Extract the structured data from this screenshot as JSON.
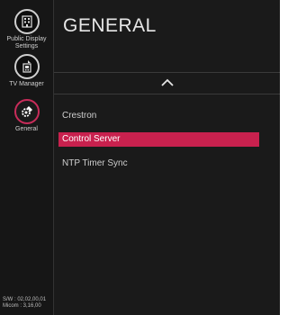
{
  "sidebar": {
    "items": [
      {
        "label": "Public Display\nSettings",
        "icon": "building-icon",
        "active": false
      },
      {
        "label": "TV Manager",
        "icon": "tv-manager-icon",
        "active": false
      },
      {
        "label": "General",
        "icon": "gear-icon",
        "active": true
      }
    ],
    "version_sw": "S/W : 02,02,00,01",
    "version_micom": "Micom : 3,16,00"
  },
  "main": {
    "title": "GENERAL",
    "scroll_icon": "chevron-up-icon",
    "menu": [
      {
        "label": "Crestron",
        "selected": false
      },
      {
        "label": "Control Server",
        "selected": true
      },
      {
        "label": "NTP Timer Sync",
        "selected": false
      }
    ]
  },
  "colors": {
    "accent": "#c8214e",
    "background": "#1a1a1a",
    "text": "#cfcfcf"
  }
}
